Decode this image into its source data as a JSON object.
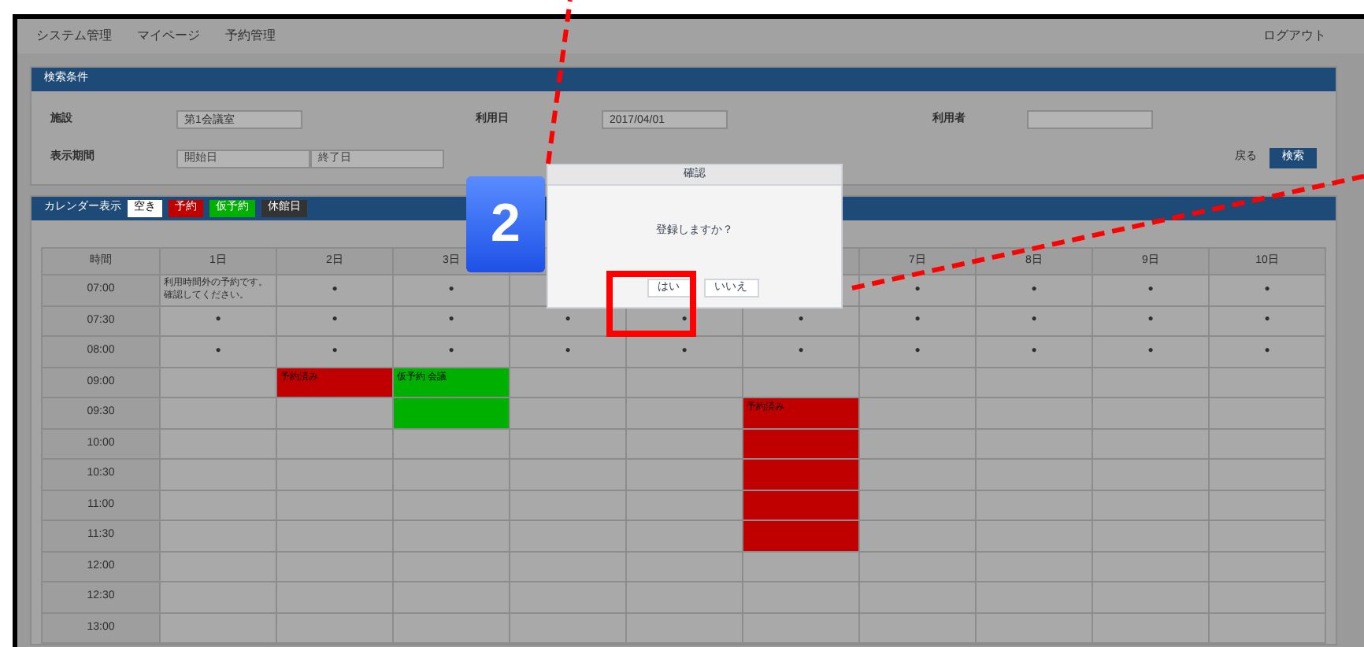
{
  "header": {
    "title": "システム管理",
    "menu": [
      "マイページ",
      "予約管理"
    ],
    "logout": "ログアウト"
  },
  "search_panel": {
    "title": "検索条件",
    "fields": [
      {
        "label": "施設",
        "value": "第1会議室"
      },
      {
        "label": "利用日",
        "value": "2017/04/01"
      },
      {
        "label": "利用者"
      }
    ],
    "period": {
      "label": "表示期間",
      "from_placeholder": "開始日",
      "to_placeholder": "終了日"
    },
    "back": "戻る",
    "search_button": "検索"
  },
  "calendar": {
    "title": "カレンダー表示",
    "legend": [
      {
        "label": "空き",
        "color": "#ffffff"
      },
      {
        "label": "予約",
        "color": "#c00000"
      },
      {
        "label": "仮予約",
        "color": "#00b000"
      },
      {
        "label": "休館日",
        "color": "#333333"
      }
    ],
    "corner": "時間",
    "columns": [
      "1日",
      "2日",
      "3日",
      null,
      null,
      null,
      "7日",
      "8日",
      "9日",
      "10日"
    ],
    "mark_rows": [
      {
        "time": "07:00",
        "note": "利用時間外の予約です。確認してください。",
        "cells": [
          "●",
          "●",
          null,
          null,
          null,
          "●",
          "●",
          "●",
          "●"
        ]
      },
      {
        "time": "07:30",
        "cells": [
          "●",
          "●",
          "●",
          "●",
          "●",
          "●",
          "●",
          "●",
          "●",
          "●"
        ]
      },
      {
        "time": "08:00",
        "cells": [
          "●",
          "●",
          "●",
          "●",
          "●",
          "●",
          "●",
          "●",
          "●",
          "●"
        ]
      }
    ],
    "time_rows": [
      {
        "time": "09:00",
        "cells": [
          {
            "kind": "free"
          },
          {
            "kind": "booked",
            "text": "予約済み"
          },
          {
            "kind": "tentative",
            "text": "仮予約 会議"
          },
          {
            "kind": "free"
          },
          {
            "kind": "free"
          },
          {
            "kind": "free"
          },
          {
            "kind": "free"
          },
          {
            "kind": "free"
          },
          {
            "kind": "free"
          },
          {
            "kind": "free"
          }
        ]
      },
      {
        "time": "09:30",
        "cells": [
          {
            "kind": "free"
          },
          {
            "kind": "free"
          },
          {
            "kind": "tentative"
          },
          {
            "kind": "free"
          },
          {
            "kind": "free"
          },
          {
            "kind": "booked",
            "text": "予約済み"
          },
          {
            "kind": "free"
          },
          {
            "kind": "free"
          },
          {
            "kind": "free"
          },
          {
            "kind": "free"
          }
        ]
      },
      {
        "time": "10:00",
        "cells": [
          {
            "kind": "free"
          },
          {
            "kind": "free"
          },
          {
            "kind": "free"
          },
          {
            "kind": "free"
          },
          {
            "kind": "free"
          },
          {
            "kind": "booked"
          },
          {
            "kind": "free"
          },
          {
            "kind": "free"
          },
          {
            "kind": "free"
          },
          {
            "kind": "free"
          }
        ]
      },
      {
        "time": "10:30",
        "cells": [
          {
            "kind": "free"
          },
          {
            "kind": "free"
          },
          {
            "kind": "free"
          },
          {
            "kind": "free"
          },
          {
            "kind": "free"
          },
          {
            "kind": "booked"
          },
          {
            "kind": "free"
          },
          {
            "kind": "free"
          },
          {
            "kind": "free"
          },
          {
            "kind": "free"
          }
        ]
      },
      {
        "time": "11:00",
        "cells": [
          {
            "kind": "free"
          },
          {
            "kind": "free"
          },
          {
            "kind": "free"
          },
          {
            "kind": "free"
          },
          {
            "kind": "free"
          },
          {
            "kind": "booked"
          },
          {
            "kind": "free"
          },
          {
            "kind": "free"
          },
          {
            "kind": "free"
          },
          {
            "kind": "free"
          }
        ]
      },
      {
        "time": "11:30",
        "cells": [
          {
            "kind": "free"
          },
          {
            "kind": "free"
          },
          {
            "kind": "free"
          },
          {
            "kind": "free"
          },
          {
            "kind": "free"
          },
          {
            "kind": "booked"
          },
          {
            "kind": "free"
          },
          {
            "kind": "free"
          },
          {
            "kind": "free"
          },
          {
            "kind": "free"
          }
        ]
      },
      {
        "time": "12:00",
        "cells": [
          {
            "kind": "free"
          },
          {
            "kind": "free"
          },
          {
            "kind": "free"
          },
          {
            "kind": "free"
          },
          {
            "kind": "free"
          },
          {
            "kind": "free"
          },
          {
            "kind": "free"
          },
          {
            "kind": "free"
          },
          {
            "kind": "free"
          },
          {
            "kind": "free"
          }
        ]
      },
      {
        "time": "12:30",
        "cells": [
          {
            "kind": "free"
          },
          {
            "kind": "free"
          },
          {
            "kind": "free"
          },
          {
            "kind": "free"
          },
          {
            "kind": "free"
          },
          {
            "kind": "free"
          },
          {
            "kind": "free"
          },
          {
            "kind": "free"
          },
          {
            "kind": "free"
          },
          {
            "kind": "free"
          }
        ]
      },
      {
        "time": "13:00",
        "cells": [
          {
            "kind": "free"
          },
          {
            "kind": "free"
          },
          {
            "kind": "free"
          },
          {
            "kind": "free"
          },
          {
            "kind": "free"
          },
          {
            "kind": "free"
          },
          {
            "kind": "free"
          },
          {
            "kind": "free"
          },
          {
            "kind": "free"
          },
          {
            "kind": "free"
          }
        ]
      }
    ]
  },
  "dialog": {
    "title": "確認",
    "message": "登録しますか？",
    "ok": "はい",
    "cancel": "いいえ"
  },
  "callout": {
    "number": "2"
  }
}
